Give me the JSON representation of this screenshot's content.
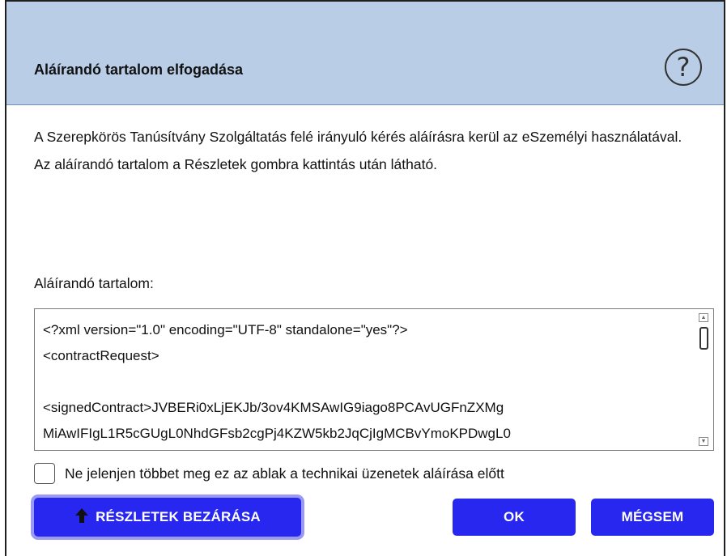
{
  "dialog": {
    "title": "Aláírandó tartalom elfogadása",
    "help_icon": "help-circle-icon",
    "help_glyph": "?",
    "description": "A Szerepkörös Tanúsítvány Szolgáltatás felé irányuló kérés aláírásra kerül az eSzemélyi használatával. Az aláírandó tartalom a Részletek gombra kattintás után látható.",
    "content_label": "Aláírandó tartalom:",
    "content_text": "<?xml version=\"1.0\" encoding=\"UTF-8\" standalone=\"yes\"?>\n<contractRequest>\n\n<signedContract>JVBERi0xLjEKJb/3ov4KMSAwIG9iago8PCAvUGFnZXMg\nMiAwIFIgL1R5cGUgL0NhdGFsb2cgPj4KZW5kb2JqCjIgMCBvYmoKPDwgL0",
    "checkbox_label": "Ne jelenjen többet meg ez az ablak a technikai üzenetek aláírása előtt",
    "checkbox_checked": false,
    "buttons": {
      "details_label": "RÉSZLETEK BEZÁRÁSA",
      "details_icon": "arrow-up-icon",
      "ok_label": "OK",
      "cancel_label": "MÉGSEM"
    }
  },
  "colors": {
    "header_bg": "#b9cde6",
    "button_bg": "#2727f0",
    "button_focus_ring": "#9a9af5"
  }
}
